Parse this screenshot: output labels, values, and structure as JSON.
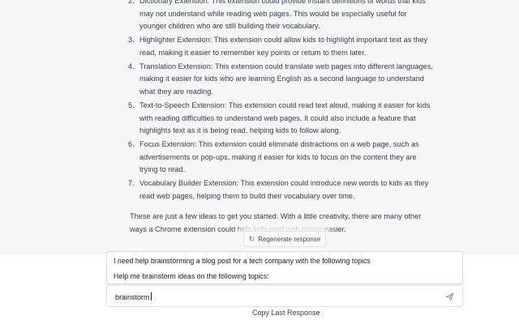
{
  "conversation": {
    "items": [
      {
        "num": "2.",
        "text": "Dictionary Extension: This extension could provide instant definitions of words that kids may not understand while reading web pages. This would be especially useful for younger children who are still building their vocabulary."
      },
      {
        "num": "3.",
        "text": "Highlighter Extension: This extension could allow kids to highlight important text as they read, making it easier to remember key points or return to them later."
      },
      {
        "num": "4.",
        "text": "Translation Extension: This extension could translate web pages into different languages, making it easier for kids who are learning English as a second language to understand what they are reading."
      },
      {
        "num": "5.",
        "text": "Text-to-Speech Extension: This extension could read text aloud, making it easier for kids with reading difficulties to understand web pages. It could also include a feature that highlights text as it is being read, helping kids to follow along."
      },
      {
        "num": "6.",
        "text": "Focus Extension: This extension could eliminate distractions on a web page, such as advertisements or pop-ups, making it easier for kids to focus on the content they are trying to read."
      },
      {
        "num": "7.",
        "text": "Vocabulary Builder Extension: This extension could introduce new words to kids as they read web pages, helping them to build their vocabulary over time."
      }
    ],
    "closing": "These are just a few ideas to get you started. With a little creativity, there are many other ways a Chrome extension could help kids read web pages easier."
  },
  "regenerate": {
    "label": "Regenerate response",
    "icon": "refresh-icon"
  },
  "prompt_suggestions": {
    "line1": "I need help brainstorming a blog post for a tech company with the following topics",
    "line2": "Help me brainstorm ideas on the following topics:"
  },
  "input": {
    "value": "brainstorm",
    "send_icon": "send-icon"
  },
  "footer": {
    "copy_label": "Copy Last Response"
  }
}
